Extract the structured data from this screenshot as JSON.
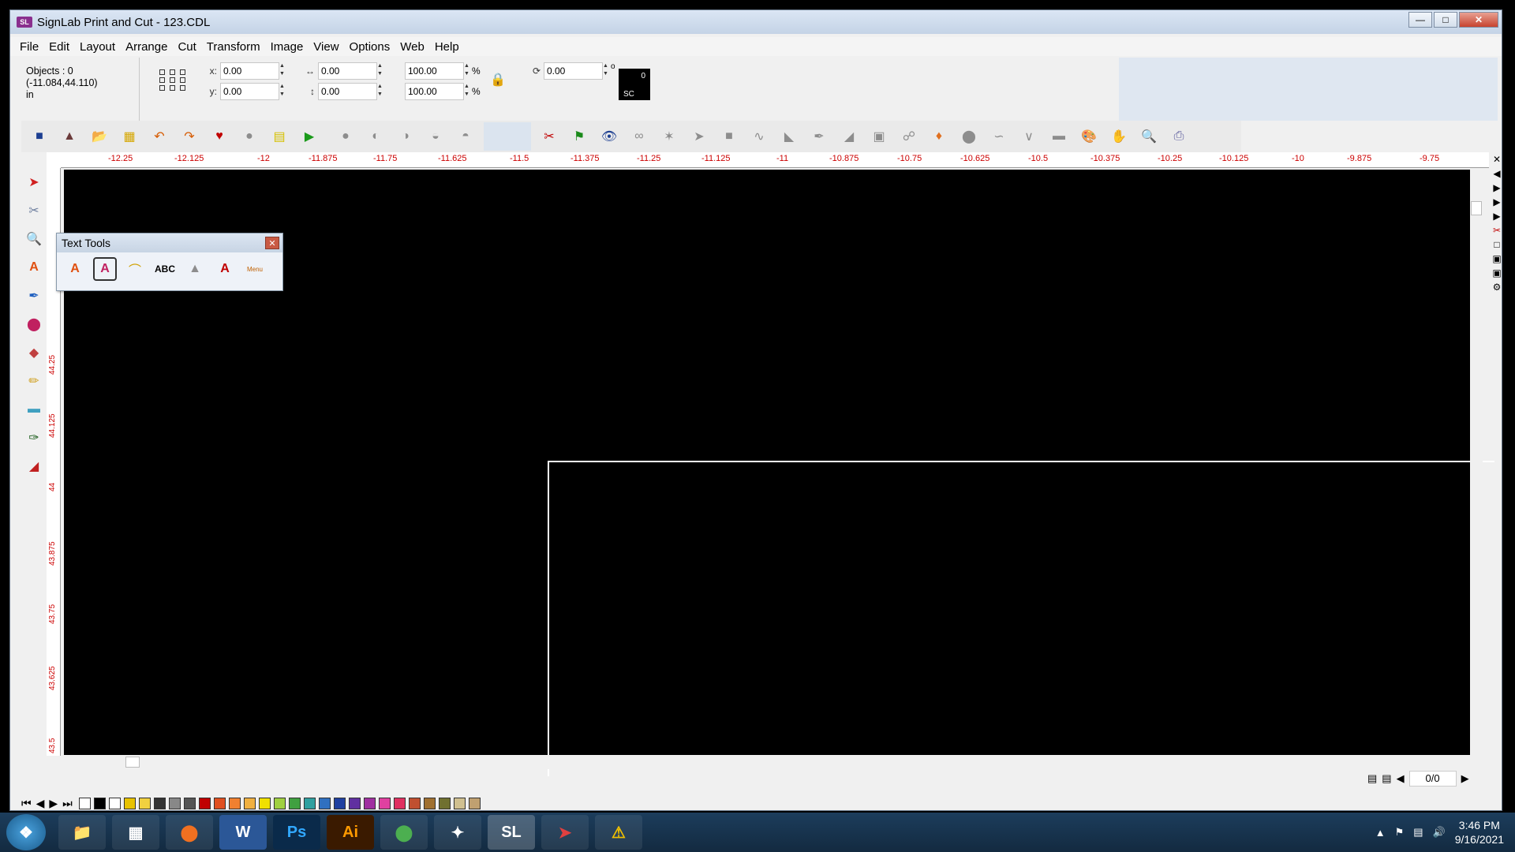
{
  "window": {
    "title": "SignLab Print and Cut - 123.CDL",
    "logo": "SL"
  },
  "menu": [
    "File",
    "Edit",
    "Layout",
    "Arrange",
    "Cut",
    "Transform",
    "Image",
    "View",
    "Options",
    "Web",
    "Help"
  ],
  "properties": {
    "objects": "Objects : 0",
    "coords": "(-11.084,44.110)",
    "units": "in",
    "x_label": "x:",
    "x": "0.00",
    "y_label": "y:",
    "y": "0.00",
    "width": "0.00",
    "height": "0.00",
    "scale_w": "100.00",
    "scale_h": "100.00",
    "percent": "%",
    "rotation": "0.00",
    "degree": "o",
    "sc_count": "0",
    "sc_label": "SC"
  },
  "ruler_top": [
    "-12.25",
    "-12.125",
    "-12",
    "-11.875",
    "-11.75",
    "-11.625",
    "-11.5",
    "-11.375",
    "-11.25",
    "-11.125",
    "-11",
    "-10.875",
    "-10.75",
    "-10.625",
    "-10.5",
    "-10.375",
    "-10.25",
    "-10.125",
    "-10",
    "-9.875",
    "-9.75"
  ],
  "ruler_left": [
    "44.25",
    "44.125",
    "44",
    "43.875",
    "43.75",
    "43.625",
    "43.5"
  ],
  "text_tools": {
    "title": "Text Tools",
    "icons": [
      "text-a-icon",
      "text-frame-icon",
      "arc-text-icon",
      "spellcheck-icon",
      "text-path-icon",
      "text-effects-icon",
      "menu-icon"
    ],
    "menu_label": "Menu",
    "abc_label": "ABC"
  },
  "page_nav": {
    "value": "0/0"
  },
  "taskbar": {
    "time": "3:46 PM",
    "date": "9/16/2021",
    "apps": [
      "Explorer",
      "Calculator",
      "Firefox",
      "W",
      "Ps",
      "Ai",
      "Chrome",
      "Photo",
      "SL",
      "Paint",
      "Warning"
    ]
  },
  "colors": {
    "canvas": "#000000",
    "ruler_text": "#cc0000",
    "accent": "#8a2f8e"
  }
}
